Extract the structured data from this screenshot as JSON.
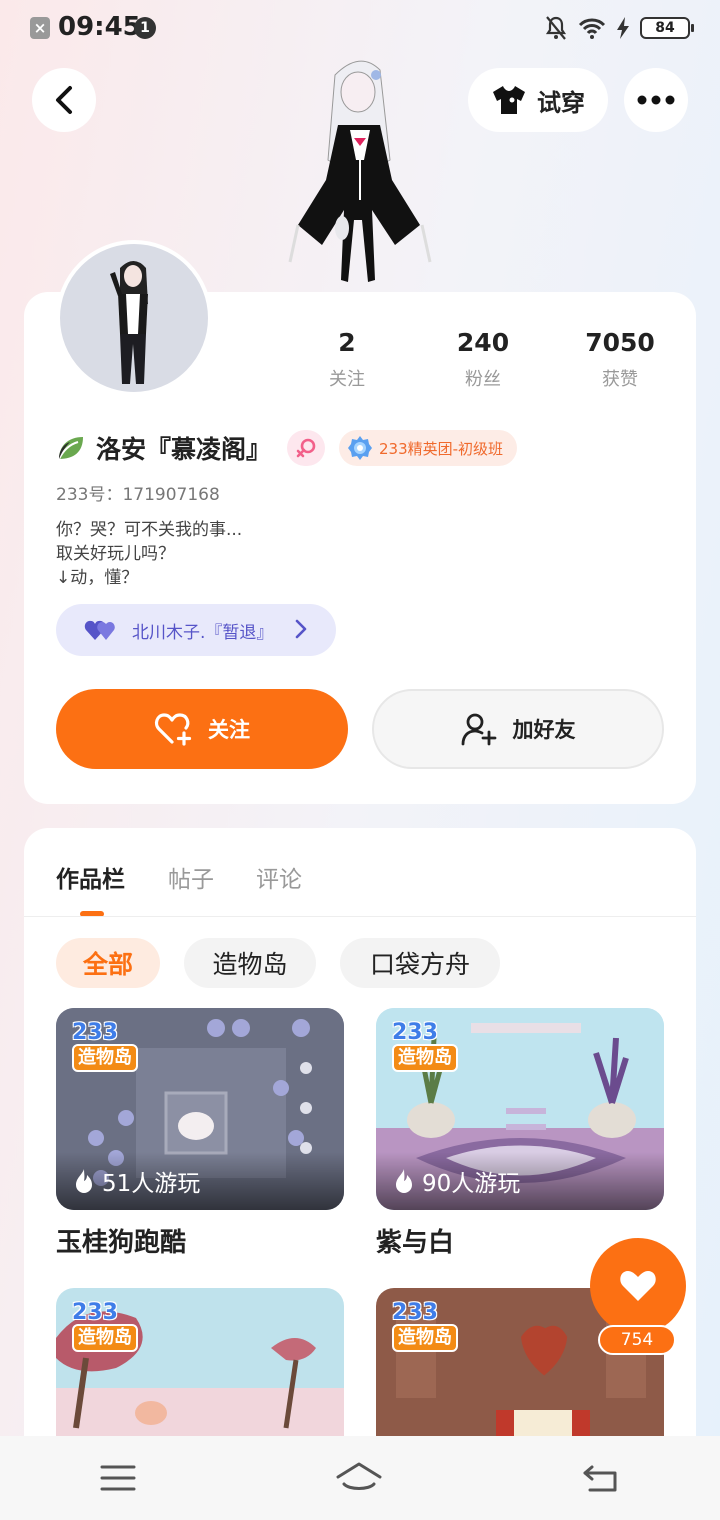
{
  "status_bar": {
    "time": "09:45",
    "notification_count": "1",
    "battery": "84"
  },
  "header": {
    "tryon_label": "试穿"
  },
  "stats": [
    {
      "value": "2",
      "label": "关注"
    },
    {
      "value": "240",
      "label": "粉丝"
    },
    {
      "value": "7050",
      "label": "获赞"
    }
  ],
  "profile": {
    "name": "洛安『慕凌阁』",
    "rank_badge": "233精英团-初级班",
    "uid": "233号：171907168",
    "bio": "你？哭？可不关我的事...\n取关好玩儿吗？\n↓动，懂？",
    "fan_group": "北川木子.『暂退』"
  },
  "actions": {
    "follow_label": "关注",
    "add_friend_label": "加好友"
  },
  "tabs": [
    "作品栏",
    "帖子",
    "评论"
  ],
  "filters": [
    "全部",
    "造物岛",
    "口袋方舟"
  ],
  "game_logo": {
    "line1": "233",
    "line2": "造物岛"
  },
  "games": [
    {
      "title": "玉桂狗跑酷",
      "plays": "51人游玩"
    },
    {
      "title": "紫与白",
      "plays": "90人游玩"
    },
    {
      "title": "",
      "plays": ""
    },
    {
      "title": "",
      "plays": ""
    }
  ],
  "like_fab": {
    "count": "754"
  },
  "colors": {
    "accent": "#fc7013",
    "fan_pill_text": "#5654c8"
  }
}
